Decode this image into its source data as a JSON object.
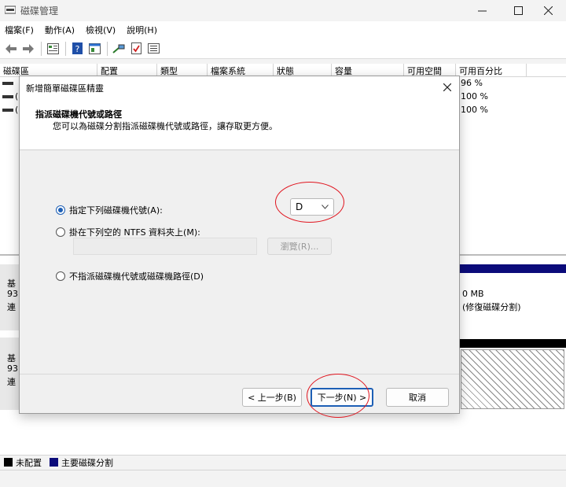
{
  "window": {
    "title": "磁碟管理"
  },
  "menu": [
    "檔案(F)",
    "動作(A)",
    "檢視(V)",
    "說明(H)"
  ],
  "toolbar": {
    "icons": [
      "back-arrow-icon",
      "forward-arrow-icon",
      "grid-view-icon",
      "help-icon",
      "properties-icon",
      "connect-icon",
      "checklist-icon",
      "list-icon"
    ]
  },
  "volume_table": {
    "columns": [
      "磁碟區",
      "配置",
      "類型",
      "檔案系統",
      "狀態",
      "容量",
      "可用空間",
      "可用百分比"
    ],
    "rows": [
      {
        "name": "",
        "pct": "96 %"
      },
      {
        "name": "(",
        "pct": "100 %"
      },
      {
        "name": "(",
        "pct": "100 %"
      }
    ]
  },
  "disk_map": {
    "disk1": {
      "label": "基",
      "size": "93",
      "status": "連",
      "cell_line1": "0 MB",
      "cell_line2": "(修復磁碟分割)"
    },
    "disk2": {
      "label": "基",
      "size": "93",
      "status": "連"
    }
  },
  "legend": [
    "未配置",
    "主要磁碟分割"
  ],
  "colors": {
    "unallocated": "#000000",
    "primary_partition": "#0b0b7a",
    "accent": "#1d5fb5",
    "annotation": "#e0141e"
  },
  "wizard": {
    "title": "新增簡單磁碟區精靈",
    "heading": "指派磁碟機代號或路徑",
    "subheading": "您可以為磁碟分割指派磁碟機代號或路徑，讓存取更方便。",
    "option_letter": "指定下列磁碟機代號(A):",
    "drive_letter": "D",
    "option_folder": "掛在下列空的 NTFS 資料夾上(M):",
    "folder_value": "",
    "browse": "瀏覽(R)...",
    "option_none": "不指派磁碟機代號或磁碟機路徑(D)",
    "back": "< 上一步(B)",
    "next": "下一步(N) >",
    "cancel": "取消"
  }
}
